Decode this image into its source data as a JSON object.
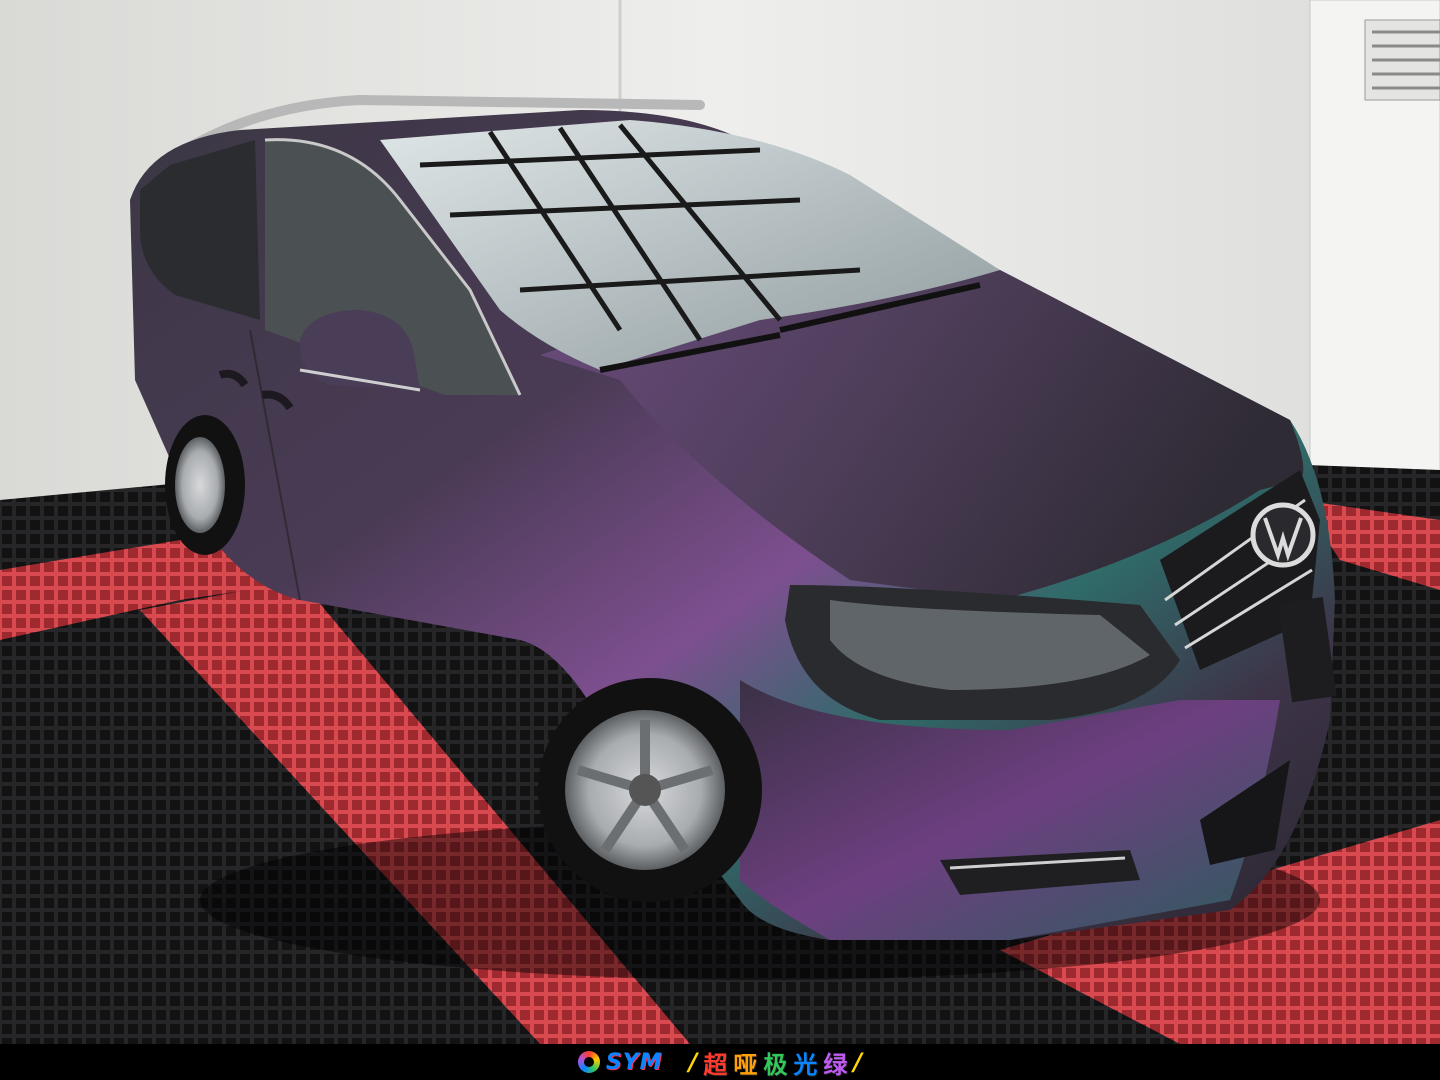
{
  "photo": {
    "subject": "matte chameleon wrapped minivan",
    "colors": {
      "wall": "#e6e6e4",
      "floor_dark": "#1c1c1e",
      "floor_red": "#c9343a",
      "body_dark": "#3a3340",
      "body_purple": "#7a4a8c",
      "body_green": "#2e6f6a",
      "glass": "#bfc7c9"
    }
  },
  "footer": {
    "logo_text": "SYM",
    "caption_open": "/",
    "caption_chars": [
      "超",
      "哑",
      "极",
      "光",
      "绿"
    ],
    "caption_close": "/",
    "caption_colors": [
      "#ff3b30",
      "#ff9f0a",
      "#34c759",
      "#0a84ff",
      "#bf5af2"
    ]
  }
}
